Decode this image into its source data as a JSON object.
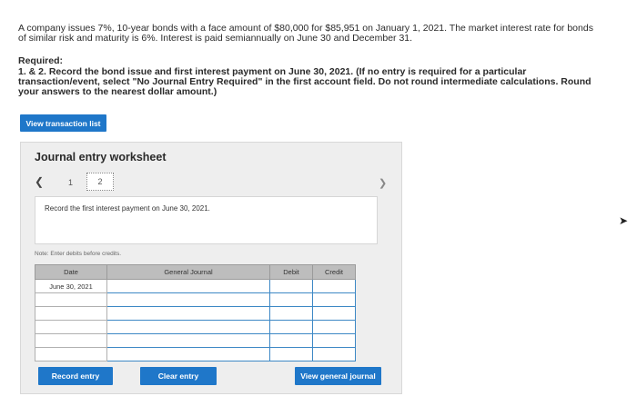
{
  "problem": {
    "text": "A company issues 7%, 10-year bonds with a face amount of $80,000 for $85,951 on January 1, 2021. The market interest rate for bonds of similar risk and maturity is 6%. Interest is paid semiannually on June 30 and December 31."
  },
  "required": {
    "heading": "Required:",
    "lead": "1. & 2. Record the bond issue and first interest payment on June 30, 2021. ",
    "instructions": "(If no entry is required for a particular transaction/event, select \"No Journal Entry Required\" in the first account field. Do not round intermediate calculations. Round your answers to the nearest dollar amount.)"
  },
  "buttons": {
    "view_transaction_list": "View transaction list",
    "record_entry": "Record entry",
    "clear_entry": "Clear entry",
    "view_general_journal": "View general journal"
  },
  "worksheet": {
    "title": "Journal entry worksheet",
    "pages": [
      "1",
      "2"
    ],
    "current_page": "2",
    "description": "Record the first interest payment on June 30, 2021.",
    "note": "Note: Enter debits before credits."
  },
  "journal": {
    "headers": {
      "date": "Date",
      "general_journal": "General Journal",
      "debit": "Debit",
      "credit": "Credit"
    },
    "date_value": "June 30, 2021"
  },
  "icons": {
    "prev": "chevron-left-icon",
    "next": "chevron-right-icon"
  },
  "colors": {
    "button_blue": "#1f77c9",
    "input_border": "#3d88c5",
    "header_gray": "#bdbdbd"
  }
}
